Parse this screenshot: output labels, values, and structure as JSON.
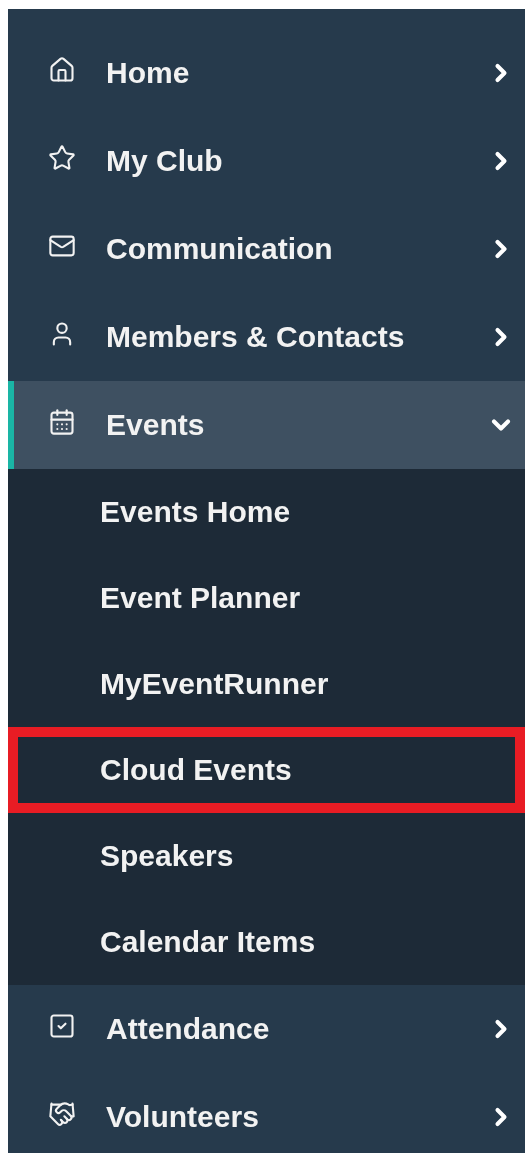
{
  "menu": {
    "items": [
      {
        "label": "Home",
        "selected": false,
        "expanded": false
      },
      {
        "label": "My Club",
        "selected": false,
        "expanded": false
      },
      {
        "label": "Communication",
        "selected": false,
        "expanded": false
      },
      {
        "label": "Members & Contacts",
        "selected": false,
        "expanded": false
      },
      {
        "label": "Events",
        "selected": true,
        "expanded": true,
        "children": [
          {
            "label": "Events Home",
            "highlighted": false
          },
          {
            "label": "Event Planner",
            "highlighted": false
          },
          {
            "label": "MyEventRunner",
            "highlighted": false
          },
          {
            "label": "Cloud Events",
            "highlighted": true
          },
          {
            "label": "Speakers",
            "highlighted": false
          },
          {
            "label": "Calendar Items",
            "highlighted": false
          }
        ]
      },
      {
        "label": "Attendance",
        "selected": false,
        "expanded": false
      },
      {
        "label": "Volunteers",
        "selected": false,
        "expanded": false
      }
    ]
  }
}
